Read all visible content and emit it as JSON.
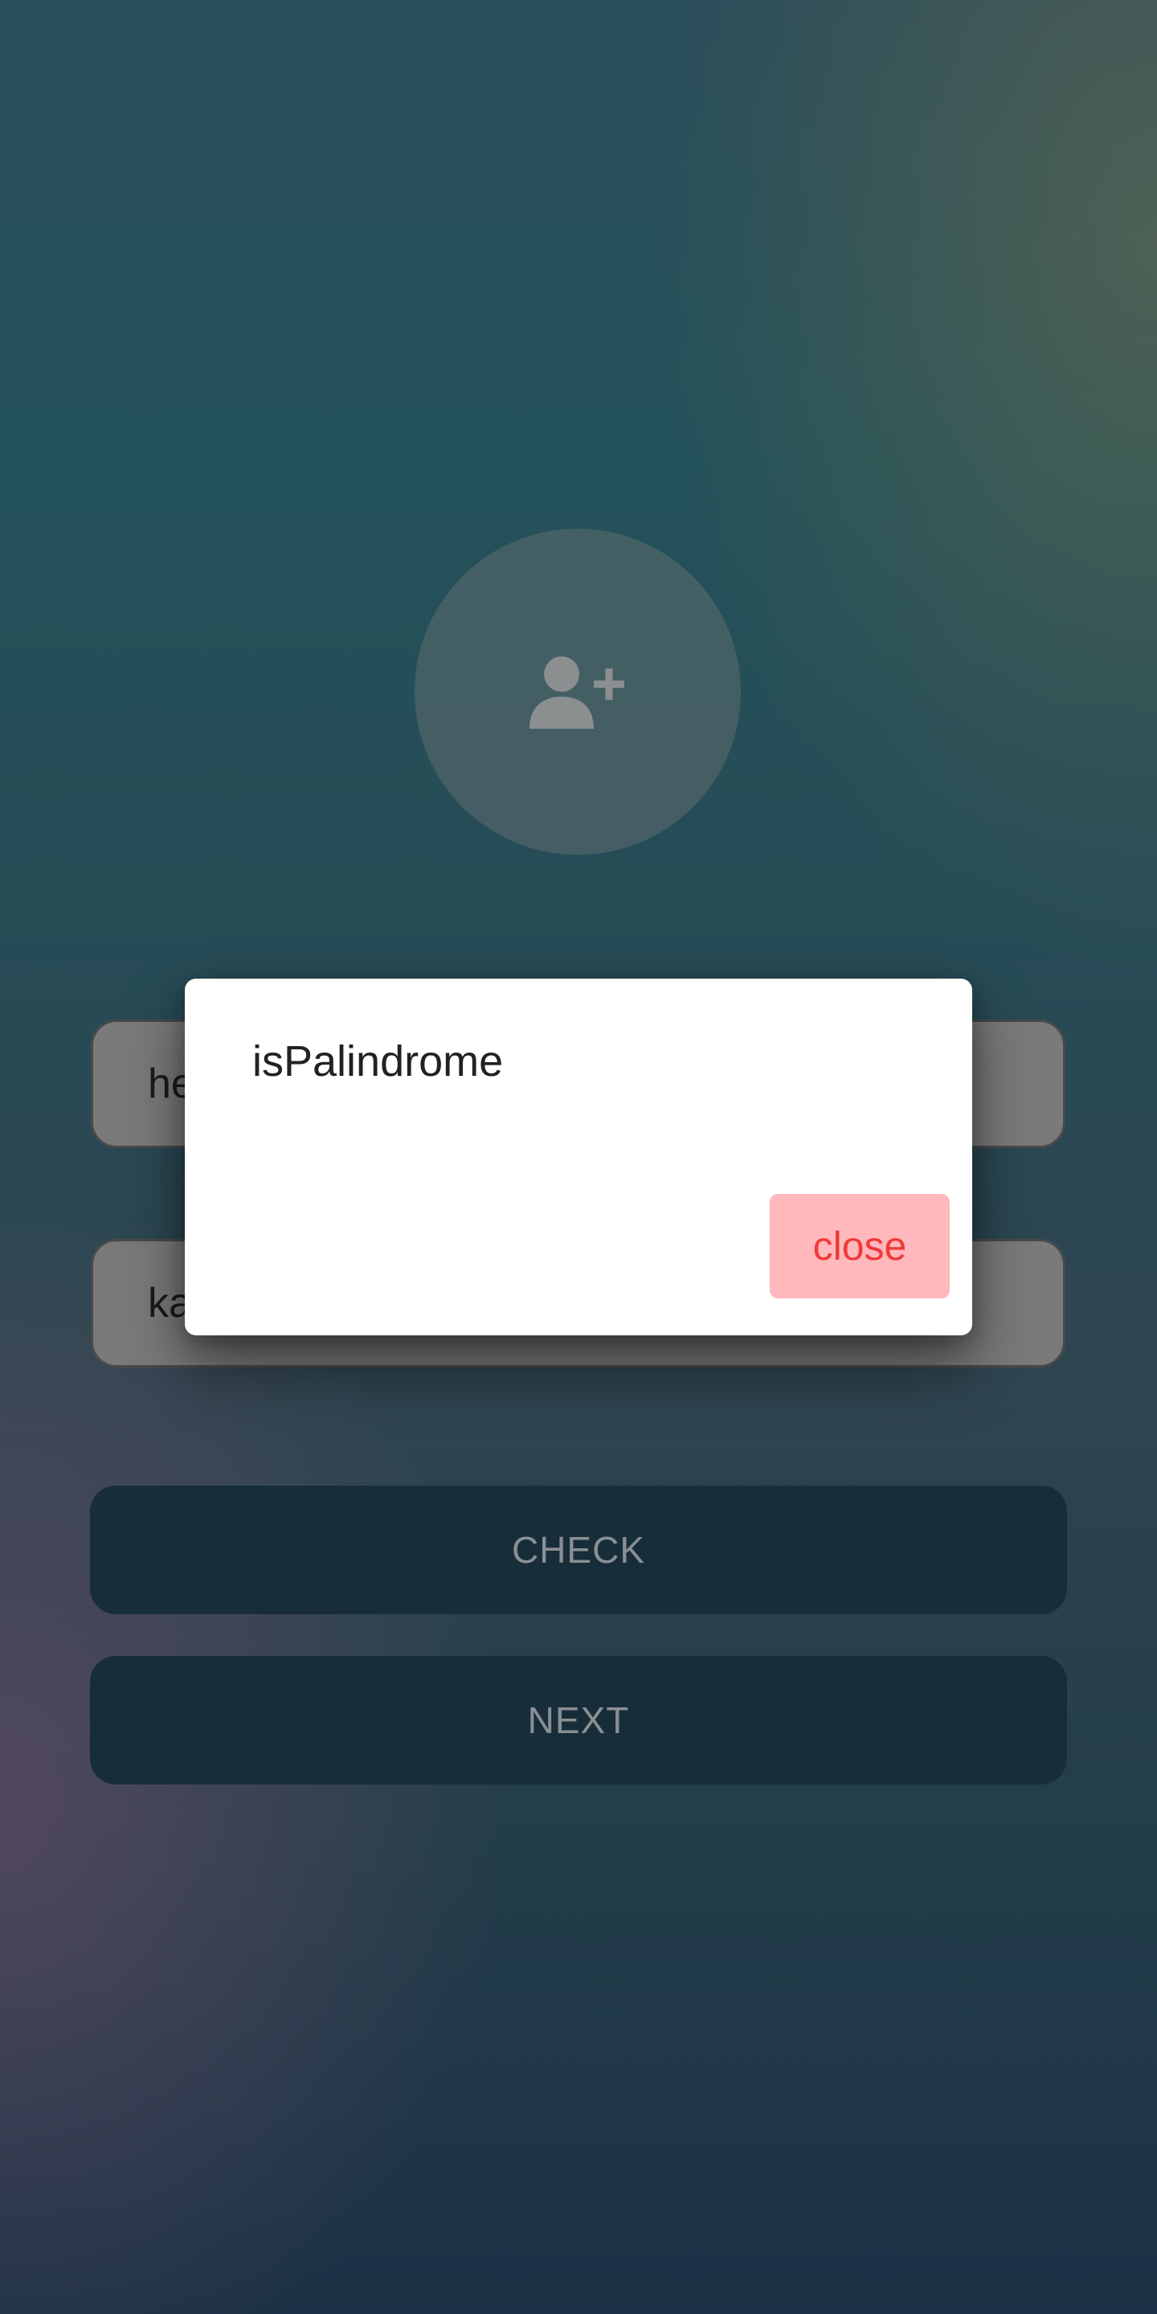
{
  "avatar": {
    "icon": "person-add-icon"
  },
  "form": {
    "field_1_value": "he",
    "field_2_value": "ka"
  },
  "buttons": {
    "check_label": "CHECK",
    "next_label": "NEXT"
  },
  "dialog": {
    "title": "isPalindrome",
    "close_label": "close"
  },
  "colors": {
    "dialog_close_bg": "#ffb8bb",
    "dialog_close_text": "#f03a3a",
    "button_bg": "#172e3a"
  }
}
